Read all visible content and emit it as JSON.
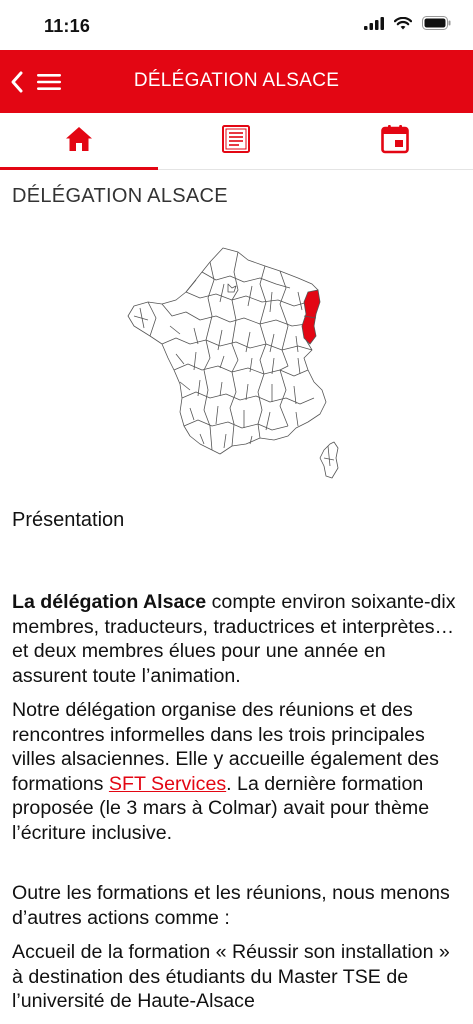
{
  "status": {
    "time": "11:16"
  },
  "header": {
    "title": "DÉLÉGATION ALSACE"
  },
  "tabs": [
    {
      "name": "home",
      "icon": "home-icon"
    },
    {
      "name": "documents",
      "icon": "document-icon"
    },
    {
      "name": "calendar",
      "icon": "calendar-icon"
    }
  ],
  "page": {
    "heading": "DÉLÉGATION ALSACE",
    "section_title": "Présentation",
    "p1_bold": "La délégation Alsace",
    "p1_rest": " compte environ soixante-dix membres, traducteurs, traductrices et interprètes… et deux membres élues pour une année en assurent toute l’animation.",
    "p2_a": "Notre délégation organise des réunions et des rencontres informelles dans les trois principales villes alsaciennes. Elle y accueille également des formations ",
    "p2_link": "SFT Services",
    "p2_b": ". La dernière formation proposée (le 3 mars à Colmar) avait pour thème l’écriture inclusive.",
    "p3": "Outre les formations et les réunions, nous menons d’autres actions comme :",
    "p4": "Accueil de la formation « Réussir son installation » à destination des étudiants du Master TSE de l’université de Haute-Alsace"
  },
  "colors": {
    "accent": "#e30613"
  }
}
